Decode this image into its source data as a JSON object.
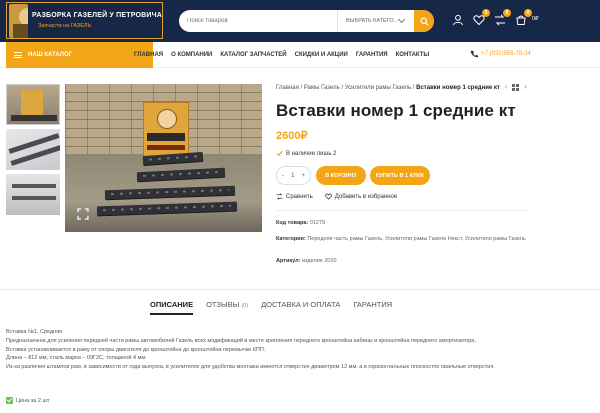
{
  "header": {
    "logo_title": "РАЗБОРКА ГАЗЕЛЕЙ У ПЕТРОВИЧА",
    "logo_subtitle": "Запчасти на ГАЗЕЛЬ",
    "search_placeholder": "Поиск товаров",
    "search_category": "ВЫБРАТЬ КАТЕГО...",
    "wishlist_count": "0",
    "compare_count": "0",
    "cart_count": "0",
    "cart_total": "0₽"
  },
  "nav": {
    "catalog_label": "НАШ КАТАЛОГ",
    "items": [
      "ГЛАВНАЯ",
      "О КОМПАНИИ",
      "КАТАЛОГ ЗАПЧАСТЕЙ",
      "СКИДКИ И АКЦИИ",
      "ГАРАНТИЯ",
      "КОНТАКТЫ"
    ],
    "phone": "+7 (932)956-78-34"
  },
  "breadcrumb": {
    "home": "Главная",
    "level1": "Рамы Газель",
    "level2": "Усилители рамы Газель",
    "current": "Вставки номер 1 средние кт"
  },
  "product": {
    "title": "Вставки номер 1 средние кт",
    "price": "2600₽",
    "stock": "В наличии лишь 2",
    "qty": "1",
    "add_to_cart": "В КОРЗИНУ",
    "buy_one_click": "КУПИТЬ В 1 КЛИК",
    "compare": "Сравнить",
    "wishlist": "Добавить в избранное",
    "sku_label": "Код товара:",
    "sku": "01279",
    "categories_label": "Категории:",
    "categories": "Передняя часть рамы Газель, Усилители рамы Газели Некст, Усилители рамы Газель",
    "article_label": "Артикул:",
    "article": "изделие 2020"
  },
  "tabs": {
    "description": "ОПИСАНИЕ",
    "reviews": "ОТЗЫВЫ",
    "reviews_count": "(0)",
    "delivery": "ДОСТАВКА И ОПЛАТА",
    "warranty": "ГАРАНТИЯ"
  },
  "description": {
    "line1": "Вставка №1. Средняя",
    "line2": "Предназначена для усиления передней части рамы автомобилей Газель всех модификаций в месте крепления переднего кронштейна кабины и кронштейна переднего амортизатора.",
    "line3": "Вставка устанавливается в раму от опоры двигателя до кронштейна до кронштейна перемычки КПП.",
    "line4": "Длина – 812 мм, сталь марки – 09Г2С, толщиной 4 мм.",
    "line5": "Из-за различия штампов рам, в зависимости от года выпуска, в усилителях для удобства монтажа имеются отверстия диаметром 12 мм, а в горизонтальных плоскостях овальные отверстия.",
    "price_note": "Цена за 2 шт"
  },
  "colors": {
    "accent": "#f2a516",
    "header_bg": "#172748"
  }
}
